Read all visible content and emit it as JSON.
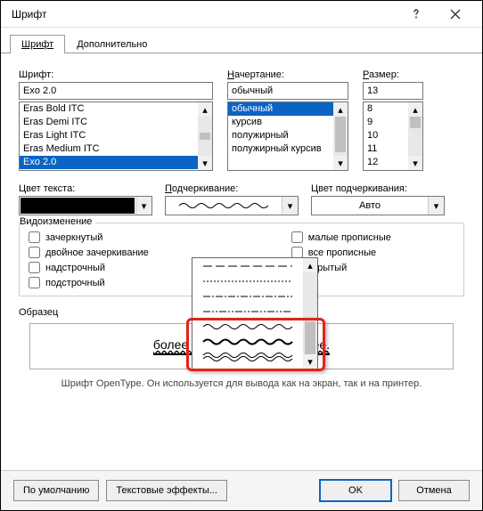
{
  "window": {
    "title": "Шрифт"
  },
  "tabs": {
    "font": "Шрифт",
    "advanced": "Дополнительно"
  },
  "labels": {
    "font": "Шрифт:",
    "style": "Начертание:",
    "size": "Размер:",
    "fontColor": "Цвет текста:",
    "underline": "Подчеркивание:",
    "underlineColor": "Цвет подчеркивания:",
    "effects": "Видоизменение",
    "sample": "Образец"
  },
  "font": {
    "value": "Exo 2.0",
    "list": [
      "Eras Bold ITC",
      "Eras Demi ITC",
      "Eras Light ITC",
      "Eras Medium ITC",
      "Exo 2.0"
    ]
  },
  "style": {
    "value": "обычный",
    "list": [
      "обычный",
      "курсив",
      "полужирный",
      "полужирный курсив"
    ]
  },
  "size": {
    "value": "13",
    "list": [
      "8",
      "9",
      "10",
      "11",
      "12"
    ]
  },
  "underlineColor": "Авто",
  "effectsCheckboxes": {
    "strike": "зачеркнутый",
    "dstrike": "двойное зачеркивание",
    "super": "надстрочный",
    "sub": "подстрочный",
    "smallcaps": "малые прописные",
    "allcaps": "все прописные",
    "hidden": "скрытый"
  },
  "sampleText": "более качественно и быстрее.",
  "footnote": "Шрифт OpenType. Он используется для вывода как на экран, так и на принтер.",
  "buttons": {
    "default": "По умолчанию",
    "textfx": "Текстовые эффекты...",
    "ok": "OK",
    "cancel": "Отмена"
  }
}
